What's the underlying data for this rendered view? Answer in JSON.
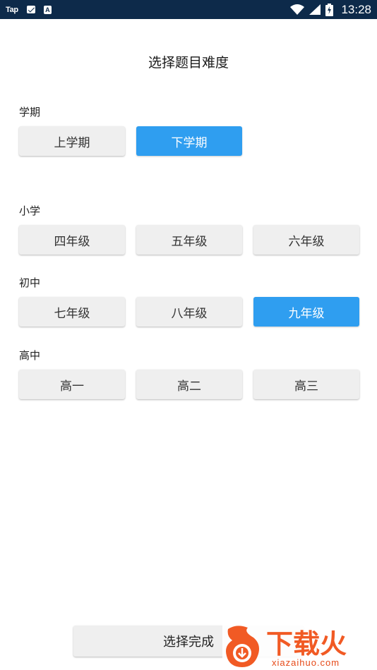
{
  "status_bar": {
    "app_label": "Tap",
    "time": "13:28"
  },
  "page": {
    "title": "选择题目难度"
  },
  "semester": {
    "label": "学期",
    "options": [
      "上学期",
      "下学期"
    ],
    "selected": "下学期"
  },
  "primary": {
    "label": "小学",
    "options": [
      "四年级",
      "五年级",
      "六年级"
    ]
  },
  "junior": {
    "label": "初中",
    "options": [
      "七年级",
      "八年级",
      "九年级"
    ],
    "selected": "九年级"
  },
  "senior": {
    "label": "高中",
    "options": [
      "高一",
      "高二",
      "高三"
    ]
  },
  "footer": {
    "done_label": "选择完成"
  },
  "watermark": {
    "brand": "下载火",
    "domain": "xiazaihuo.com"
  },
  "colors": {
    "status_bar": "#0d2a4a",
    "selected": "#2f9ef0",
    "unselected": "#efefef",
    "watermark": "#e64a19"
  }
}
